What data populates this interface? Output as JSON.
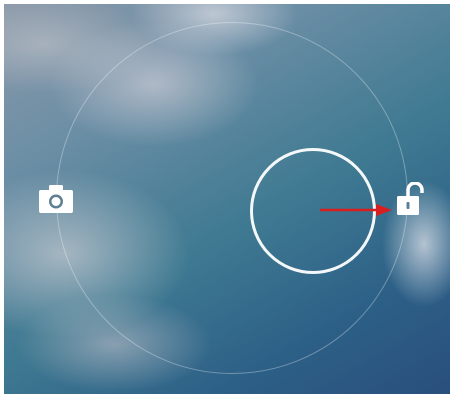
{
  "lockscreen": {
    "wallpaper": "cloudy-sky",
    "accent_color": "#ffffff",
    "gesture_arrow_color": "#d81e1e",
    "targets": [
      {
        "name": "camera",
        "icon": "camera-icon"
      },
      {
        "name": "unlock",
        "icon": "unlock-icon"
      }
    ],
    "handle_icon": "unlock-handle-circle",
    "gesture": "swipe-right"
  }
}
